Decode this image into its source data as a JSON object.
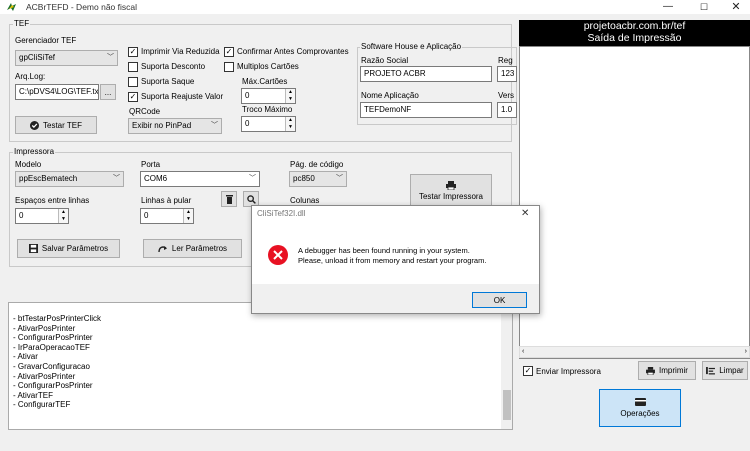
{
  "window": {
    "title": "ACBrTEFD - Demo não fiscal",
    "minimize": "—",
    "maximize": "☐",
    "close": "✕"
  },
  "tef": {
    "group_label": "TEF",
    "gerenciador_label": "Gerenciador TEF",
    "gerenciador_value": "gpCliSiTef",
    "arqlog_label": "Arq.Log:",
    "arqlog_value": "C:\\pDVS4\\LOG\\TEF.txt",
    "browse_label": "...",
    "testar_tef_label": "Testar TEF",
    "checks": {
      "imprimir_via_reduzida": {
        "label": "Imprimir Via Reduzida",
        "checked": true
      },
      "suporta_desconto": {
        "label": "Suporta Desconto",
        "checked": false
      },
      "suporta_saque": {
        "label": "Suporta Saque",
        "checked": false
      },
      "suporta_reajuste_valor": {
        "label": "Suporta Reajuste Valor",
        "checked": true
      },
      "confirmar_antes": {
        "label": "Confirmar Antes Comprovantes",
        "checked": true
      },
      "multiplos_cartoes": {
        "label": "Multiplos Cartões",
        "checked": false
      }
    },
    "max_cartoes_label": "Máx.Cartões",
    "max_cartoes_value": "0",
    "troco_maximo_label": "Troco Máximo",
    "troco_maximo_value": "0",
    "qrcode_label": "QRCode",
    "qrcode_value": "Exibir no PinPad"
  },
  "software_house": {
    "group_label": "Software House e Aplicação",
    "razao_social_label": "Razão Social",
    "razao_social_value": "PROJETO ACBR",
    "reg_label": "Reg",
    "reg_value": "123",
    "nome_aplicacao_label": "Nome Aplicação",
    "nome_aplicacao_value": "TEFDemoNF",
    "versao_label": "Vers",
    "versao_value": "1.0"
  },
  "impressora": {
    "group_label": "Impressora",
    "modelo_label": "Modelo",
    "modelo_value": "ppEscBematech",
    "porta_label": "Porta",
    "porta_value": "COM6",
    "pag_codigo_label": "Pág. de código",
    "pag_codigo_value": "pc850",
    "testar_label": "Testar Impressora",
    "espacos_label": "Espaços entre linhas",
    "espacos_value": "0",
    "linhas_pular_label": "Linhas à pular",
    "linhas_pular_value": "0",
    "colunas_label": "Colunas"
  },
  "buttons": {
    "salvar": "Salvar Parâmetros",
    "ler": "Ler Parâmetros"
  },
  "log": [
    "- btTestarPosPrinterClick",
    "- AtivarPosPrinter",
    "- ConfigurarPosPrinter",
    "- IrParaOperacaoTEF",
    "- Ativar",
    "- GravarConfiguracao",
    "- AtivarPosPrinter",
    "- ConfigurarPosPrinter",
    "- AtivarTEF",
    "- ConfigurarTEF"
  ],
  "print_panel": {
    "site": "projetoacbr.com.br/tef",
    "title": "Saída de Impressão",
    "enviar_impressora_label": "Enviar Impressora",
    "enviar_impressora_checked": true,
    "imprimir_label": "Imprimir",
    "limpar_label": "Limpar",
    "operacoes_label": "Operações"
  },
  "dialog": {
    "title": "CliSiTef32I.dll",
    "line1": "A debugger has been found running in your system.",
    "line2": "Please, unload it from memory and restart your program.",
    "ok_label": "OK",
    "close": "✕"
  },
  "colors": {
    "error_icon": "#e81123",
    "dialog_button_border": "#0078d7",
    "operacoes_bg": "#cce4f7"
  }
}
